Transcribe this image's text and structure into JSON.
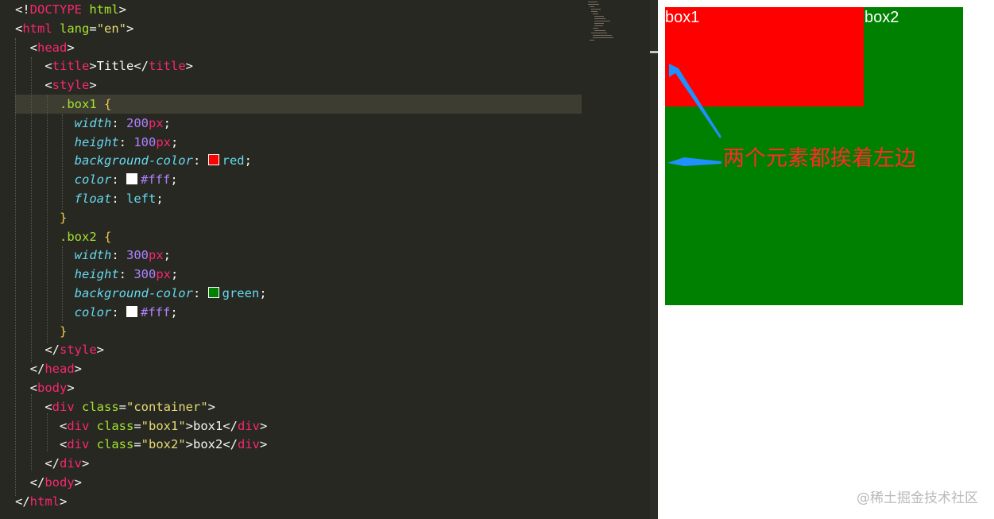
{
  "editor": {
    "lines": [
      [
        {
          "t": "<!",
          "c": "pun"
        },
        {
          "t": "DOCTYPE",
          "c": "tag"
        },
        {
          "t": " html",
          "c": "attr"
        },
        {
          "t": ">",
          "c": "pun"
        }
      ],
      [
        {
          "t": "<",
          "c": "pun"
        },
        {
          "t": "html",
          "c": "tag"
        },
        {
          "t": " lang",
          "c": "attr"
        },
        {
          "t": "=",
          "c": "pun"
        },
        {
          "t": "\"en\"",
          "c": "str"
        },
        {
          "t": ">",
          "c": "pun"
        }
      ],
      [
        {
          "t": "  <",
          "c": "pun"
        },
        {
          "t": "head",
          "c": "tag"
        },
        {
          "t": ">",
          "c": "pun"
        }
      ],
      [
        {
          "t": "    <",
          "c": "pun"
        },
        {
          "t": "title",
          "c": "tag"
        },
        {
          "t": ">Title</",
          "c": "pun"
        },
        {
          "t": "title",
          "c": "tag"
        },
        {
          "t": ">",
          "c": "pun"
        }
      ],
      [
        {
          "t": "    <",
          "c": "pun"
        },
        {
          "t": "style",
          "c": "tag"
        },
        {
          "t": ">",
          "c": "pun"
        }
      ],
      [
        {
          "t": "      .box1",
          "c": "sel"
        },
        {
          "t": " {",
          "c": "brace"
        }
      ],
      [
        {
          "t": "        ",
          "c": "pun"
        },
        {
          "t": "width",
          "c": "prop"
        },
        {
          "t": ": ",
          "c": "pun"
        },
        {
          "t": "200",
          "c": "num"
        },
        {
          "t": "px",
          "c": "unit"
        },
        {
          "t": ";",
          "c": "pun"
        }
      ],
      [
        {
          "t": "        ",
          "c": "pun"
        },
        {
          "t": "height",
          "c": "prop"
        },
        {
          "t": ": ",
          "c": "pun"
        },
        {
          "t": "100",
          "c": "num"
        },
        {
          "t": "px",
          "c": "unit"
        },
        {
          "t": ";",
          "c": "pun"
        }
      ],
      [
        {
          "t": "        ",
          "c": "pun"
        },
        {
          "t": "background-color",
          "c": "prop"
        },
        {
          "t": ": ",
          "c": "pun"
        },
        {
          "sw": "#ff0000"
        },
        {
          "t": "red",
          "c": "kw"
        },
        {
          "t": ";",
          "c": "pun"
        }
      ],
      [
        {
          "t": "        ",
          "c": "pun"
        },
        {
          "t": "color",
          "c": "prop"
        },
        {
          "t": ": ",
          "c": "pun"
        },
        {
          "sw": "#ffffff"
        },
        {
          "t": "#fff",
          "c": "num"
        },
        {
          "t": ";",
          "c": "pun"
        }
      ],
      [
        {
          "t": "        ",
          "c": "pun"
        },
        {
          "t": "float",
          "c": "prop"
        },
        {
          "t": ": ",
          "c": "pun"
        },
        {
          "t": "left",
          "c": "kw"
        },
        {
          "t": ";",
          "c": "pun"
        }
      ],
      [
        {
          "t": "      }",
          "c": "brace"
        }
      ],
      [
        {
          "t": "      .box2",
          "c": "sel"
        },
        {
          "t": " {",
          "c": "brace"
        }
      ],
      [
        {
          "t": "        ",
          "c": "pun"
        },
        {
          "t": "width",
          "c": "prop"
        },
        {
          "t": ": ",
          "c": "pun"
        },
        {
          "t": "300",
          "c": "num"
        },
        {
          "t": "px",
          "c": "unit"
        },
        {
          "t": ";",
          "c": "pun"
        }
      ],
      [
        {
          "t": "        ",
          "c": "pun"
        },
        {
          "t": "height",
          "c": "prop"
        },
        {
          "t": ": ",
          "c": "pun"
        },
        {
          "t": "300",
          "c": "num"
        },
        {
          "t": "px",
          "c": "unit"
        },
        {
          "t": ";",
          "c": "pun"
        }
      ],
      [
        {
          "t": "        ",
          "c": "pun"
        },
        {
          "t": "background-color",
          "c": "prop"
        },
        {
          "t": ": ",
          "c": "pun"
        },
        {
          "sw": "#008000"
        },
        {
          "t": "green",
          "c": "kw"
        },
        {
          "t": ";",
          "c": "pun"
        }
      ],
      [
        {
          "t": "        ",
          "c": "pun"
        },
        {
          "t": "color",
          "c": "prop"
        },
        {
          "t": ": ",
          "c": "pun"
        },
        {
          "sw": "#ffffff"
        },
        {
          "t": "#fff",
          "c": "num"
        },
        {
          "t": ";",
          "c": "pun"
        }
      ],
      [
        {
          "t": "      }",
          "c": "brace"
        }
      ],
      [
        {
          "t": "    </",
          "c": "pun"
        },
        {
          "t": "style",
          "c": "tag"
        },
        {
          "t": ">",
          "c": "pun"
        }
      ],
      [
        {
          "t": "  </",
          "c": "pun"
        },
        {
          "t": "head",
          "c": "tag"
        },
        {
          "t": ">",
          "c": "pun"
        }
      ],
      [
        {
          "t": "  <",
          "c": "pun"
        },
        {
          "t": "body",
          "c": "tag"
        },
        {
          "t": ">",
          "c": "pun"
        }
      ],
      [
        {
          "t": "    <",
          "c": "pun"
        },
        {
          "t": "div",
          "c": "tag"
        },
        {
          "t": " class",
          "c": "attr"
        },
        {
          "t": "=",
          "c": "pun"
        },
        {
          "t": "\"container\"",
          "c": "str"
        },
        {
          "t": ">",
          "c": "pun"
        }
      ],
      [
        {
          "t": "      <",
          "c": "pun"
        },
        {
          "t": "div",
          "c": "tag"
        },
        {
          "t": " class",
          "c": "attr"
        },
        {
          "t": "=",
          "c": "pun"
        },
        {
          "t": "\"box1\"",
          "c": "str"
        },
        {
          "t": ">box1</",
          "c": "pun"
        },
        {
          "t": "div",
          "c": "tag"
        },
        {
          "t": ">",
          "c": "pun"
        }
      ],
      [
        {
          "t": "      <",
          "c": "pun"
        },
        {
          "t": "div",
          "c": "tag"
        },
        {
          "t": " class",
          "c": "attr"
        },
        {
          "t": "=",
          "c": "pun"
        },
        {
          "t": "\"box2\"",
          "c": "str"
        },
        {
          "t": ">box2</",
          "c": "pun"
        },
        {
          "t": "div",
          "c": "tag"
        },
        {
          "t": ">",
          "c": "pun"
        }
      ],
      [
        {
          "t": "    </",
          "c": "pun"
        },
        {
          "t": "div",
          "c": "tag"
        },
        {
          "t": ">",
          "c": "pun"
        }
      ],
      [
        {
          "t": "  </",
          "c": "pun"
        },
        {
          "t": "body",
          "c": "tag"
        },
        {
          "t": ">",
          "c": "pun"
        }
      ],
      [
        {
          "t": "</",
          "c": "pun"
        },
        {
          "t": "html",
          "c": "tag"
        },
        {
          "t": ">",
          "c": "pun"
        }
      ]
    ]
  },
  "preview": {
    "box1_label": "box1",
    "box2_label": "box2",
    "box1_color": "#ff0000",
    "box2_color": "#008000",
    "annotation": "两个元素都挨着左边",
    "annotation_color": "#ff2a2a",
    "arrow_color": "#1e90ff"
  },
  "watermark": "@稀土掘金技术社区"
}
